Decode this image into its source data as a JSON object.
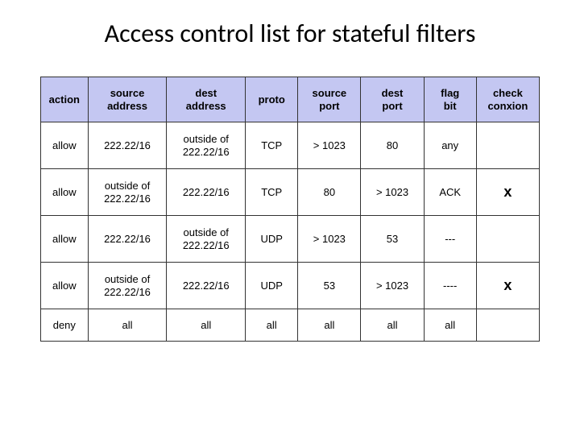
{
  "title": "Access control list for stateful filters",
  "headers": {
    "action": "action",
    "saddr": "source address",
    "daddr": "dest address",
    "proto": "proto",
    "sport": "source port",
    "dport": "dest port",
    "flag": "flag bit",
    "check": "check conxion"
  },
  "rows": [
    {
      "action": "allow",
      "saddr": "222.22/16",
      "daddr": "outside of 222.22/16",
      "proto": "TCP",
      "sport": "> 1023",
      "dport": "80",
      "flag": "any",
      "check": ""
    },
    {
      "action": "allow",
      "saddr": "outside of 222.22/16",
      "daddr": "222.22/16",
      "proto": "TCP",
      "sport": "80",
      "dport": "> 1023",
      "flag": "ACK",
      "check": "x"
    },
    {
      "action": "allow",
      "saddr": "222.22/16",
      "daddr": "outside of 222.22/16",
      "proto": "UDP",
      "sport": "> 1023",
      "dport": "53",
      "flag": "---",
      "check": ""
    },
    {
      "action": "allow",
      "saddr": "outside of 222.22/16",
      "daddr": "222.22/16",
      "proto": "UDP",
      "sport": "53",
      "dport": "> 1023",
      "flag": "----",
      "check": "x"
    },
    {
      "action": "deny",
      "saddr": "all",
      "daddr": "all",
      "proto": "all",
      "sport": "all",
      "dport": "all",
      "flag": "all",
      "check": ""
    }
  ],
  "chart_data": {
    "type": "table",
    "title": "Access control list for stateful filters",
    "columns": [
      "action",
      "source address",
      "dest address",
      "proto",
      "source port",
      "dest port",
      "flag bit",
      "check conxion"
    ],
    "data": [
      [
        "allow",
        "222.22/16",
        "outside of 222.22/16",
        "TCP",
        "> 1023",
        "80",
        "any",
        ""
      ],
      [
        "allow",
        "outside of 222.22/16",
        "222.22/16",
        "TCP",
        "80",
        "> 1023",
        "ACK",
        "x"
      ],
      [
        "allow",
        "222.22/16",
        "outside of 222.22/16",
        "UDP",
        "> 1023",
        "53",
        "---",
        ""
      ],
      [
        "allow",
        "outside of 222.22/16",
        "222.22/16",
        "UDP",
        "53",
        "> 1023",
        "----",
        "x"
      ],
      [
        "deny",
        "all",
        "all",
        "all",
        "all",
        "all",
        "all",
        ""
      ]
    ]
  }
}
